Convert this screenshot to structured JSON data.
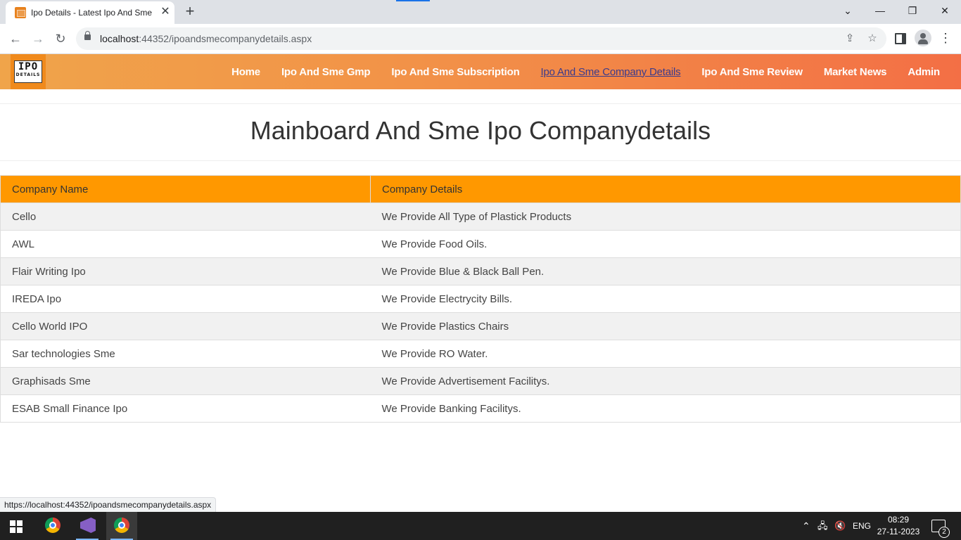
{
  "browser": {
    "tab_title": "Ipo Details - Latest Ipo And Sme",
    "tab_close": "✕",
    "new_tab": "+",
    "url_host": "localhost",
    "url_rest": ":44352/ipoandsmecompanydetails.aspx",
    "status_url": "https://localhost:44352/ipoandsmecompanydetails.aspx",
    "window_controls": {
      "minimize": "—",
      "restore": "❐",
      "close": "✕",
      "tablist": "⌄"
    }
  },
  "site": {
    "logo_main": "IPO",
    "logo_sub": "DETAILS",
    "menu": [
      {
        "label": "Home"
      },
      {
        "label": "Ipo And Sme Gmp"
      },
      {
        "label": "Ipo And Sme Subscription"
      },
      {
        "label": "Ipo And Sme Company Details"
      },
      {
        "label": "Ipo And Sme Review"
      },
      {
        "label": "Market News"
      },
      {
        "label": "Admin"
      }
    ],
    "active_menu": "Ipo And Sme Company Details",
    "page_title": "Mainboard And Sme Ipo Companydetails"
  },
  "table": {
    "headers": [
      "Company Name",
      "Company Details"
    ],
    "rows": [
      [
        "Cello",
        "We Provide All Type of Plastick Products"
      ],
      [
        "AWL",
        "We Provide Food Oils."
      ],
      [
        "Flair Writing Ipo",
        "We Provide Blue & Black Ball Pen."
      ],
      [
        "IREDA Ipo",
        "We Provide Electrycity Bills."
      ],
      [
        "Cello World IPO",
        "We Provide Plastics Chairs"
      ],
      [
        "Sar technologies Sme",
        "We Provide RO Water."
      ],
      [
        "Graphisads Sme",
        "We Provide Advertisement Facilitys."
      ],
      [
        "ESAB Small Finance Ipo",
        "We Provide Banking Facilitys."
      ]
    ]
  },
  "taskbar": {
    "language": "ENG",
    "time": "08:29",
    "date": "27-11-2023",
    "notification_count": "2"
  },
  "colors": {
    "header_start": "#f0a44a",
    "header_end": "#f36f45",
    "table_header": "#ff9800",
    "active_link": "#3b3b8c"
  }
}
